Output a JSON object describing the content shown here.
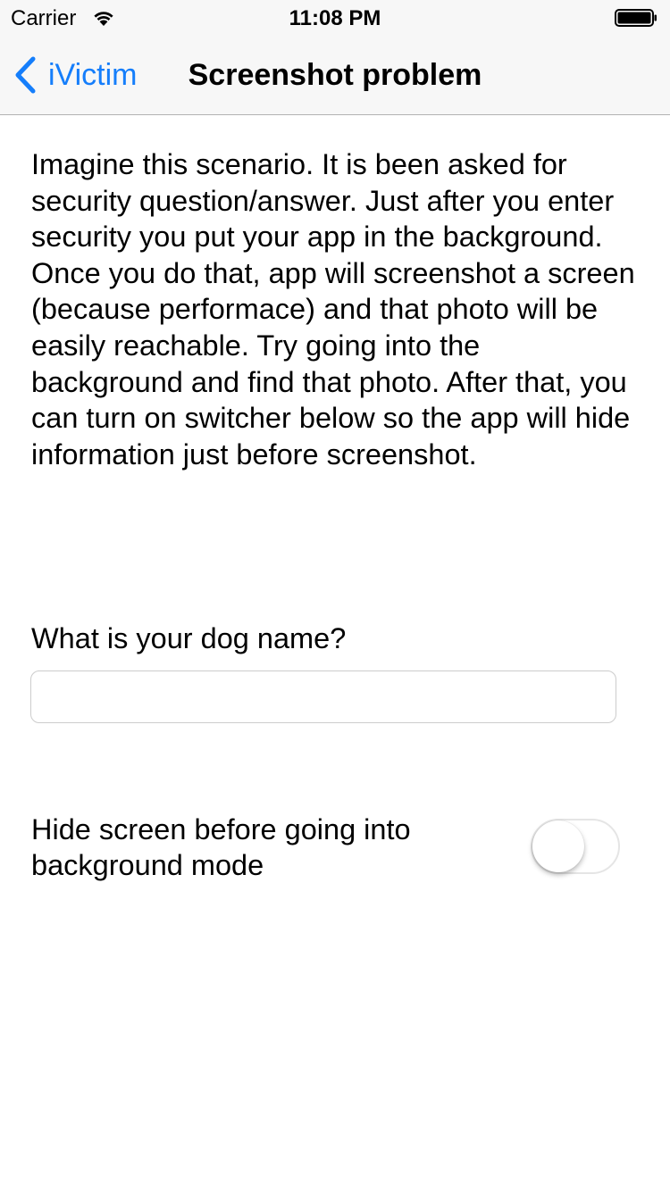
{
  "status_bar": {
    "carrier": "Carrier",
    "time": "11:08 PM",
    "wifi_icon": "wifi-icon",
    "battery_icon": "battery-full-icon"
  },
  "nav": {
    "back_label": "iVictim",
    "back_icon": "chevron-left-icon",
    "title": "Screenshot problem",
    "accent_color": "#157efb"
  },
  "content": {
    "description": "Imagine this scenario. It is been asked for security question/answer. Just after you enter security you put your app in the background. Once you do that, app will screenshot a screen (because performace) and that photo will be easily reachable. Try going into the background and find that photo. After that, you can turn on switcher below so the app will hide information just before screenshot.",
    "question_label": "What is your dog name?",
    "answer_value": "",
    "hide_label": "Hide screen before going into background mode",
    "hide_switch_on": false
  }
}
